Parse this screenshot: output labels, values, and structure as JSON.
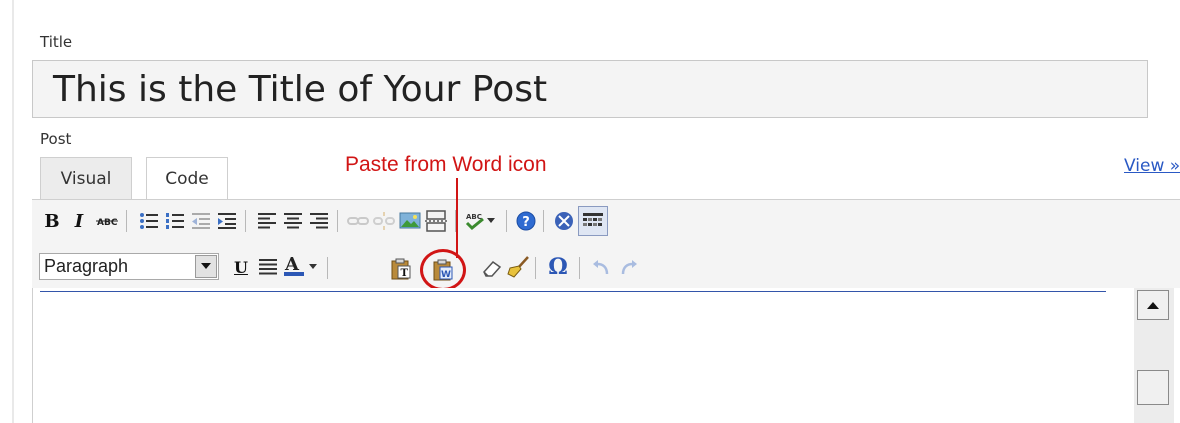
{
  "title_section": {
    "label": "Title",
    "value": "This is the Title of Your Post"
  },
  "post_section": {
    "label": "Post",
    "tabs": [
      {
        "label": "Visual",
        "active": true
      },
      {
        "label": "Code",
        "active": false
      }
    ],
    "view_link": "View »"
  },
  "annotation": {
    "text": "Paste from Word icon",
    "color": "#d11515"
  },
  "toolbar": {
    "row1": [
      "bold-icon",
      "italic-icon",
      "strikethrough-icon",
      "bullet-list-icon",
      "numbered-list-icon",
      "outdent-icon",
      "indent-icon",
      "align-left-icon",
      "align-center-icon",
      "align-right-icon",
      "link-icon",
      "unlink-icon",
      "insert-image-icon",
      "more-tag-icon",
      "spellcheck-icon",
      "help-icon",
      "fullscreen-icon",
      "kitchen-sink-icon"
    ],
    "row2": [
      "underline-icon",
      "justify-icon",
      "text-color-icon",
      "paste-text-icon",
      "paste-from-word-icon",
      "remove-format-icon",
      "cleanup-icon",
      "special-character-icon",
      "undo-icon",
      "redo-icon"
    ],
    "format_select": {
      "value": "Paragraph"
    }
  },
  "colors": {
    "accent_link": "#2a59c4",
    "toolbar_bg": "#f4f4f4",
    "editor_rule": "#3355aa"
  }
}
